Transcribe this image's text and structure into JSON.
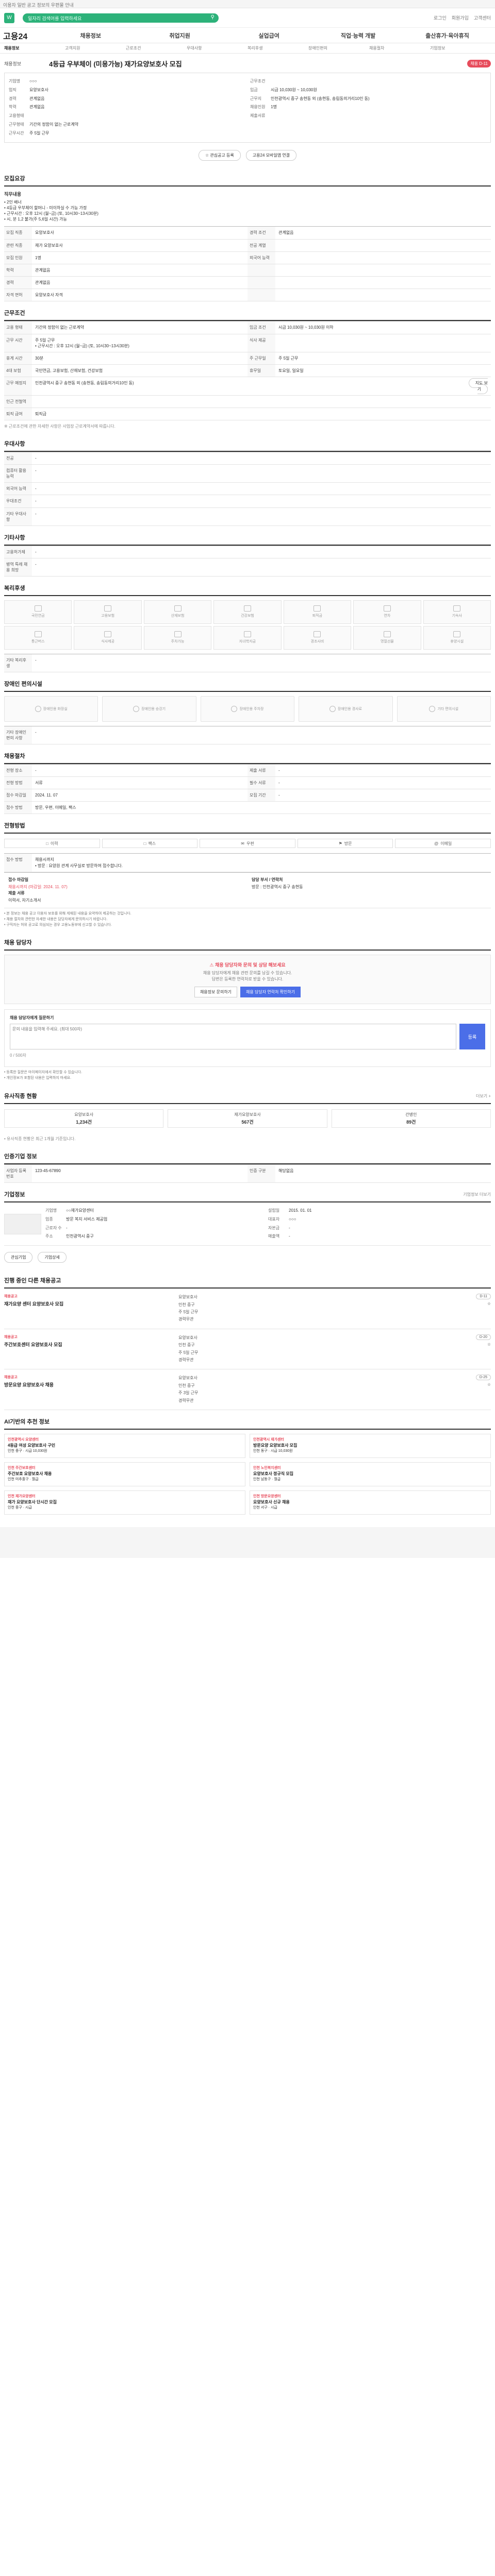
{
  "topbar": {
    "text": "이용자 일반 공고 정보의 우편물 안내"
  },
  "header": {
    "logo": "W",
    "search_placeholder": "일자리 검색어를 입력하세요",
    "links": [
      "로그인",
      "회원가입",
      "고객센터"
    ]
  },
  "gnb": {
    "brand": "고용24",
    "items": [
      "채용정보",
      "취업지원",
      "실업급여",
      "직업·능력 개발",
      "출산휴가·육아휴직"
    ]
  },
  "subnav": {
    "items": [
      "채용정보",
      "고객지원",
      "근로조건",
      "우대사항",
      "복리후생",
      "장애인편의",
      "채용절차",
      "기업정보"
    ]
  },
  "job": {
    "category": "채용정보",
    "title": "4등급 우부체이 (미용가능) 재가요양보호사 모집",
    "badge": "채용 D-11",
    "left_rows": [
      {
        "k": "기업명",
        "v": "○○○"
      },
      {
        "k": "업직",
        "v": "요양보호사"
      },
      {
        "k": "경력",
        "v": "관계없음"
      },
      {
        "k": "학력",
        "v": "관계없음"
      },
      {
        "k": "고용형태",
        "v": ""
      },
      {
        "k": "근무형태",
        "v": "기간의 정함이 없는 근로계약"
      },
      {
        "k": "근무시간",
        "v": "주 5일 근무"
      }
    ],
    "right_rows": [
      {
        "k": "근무조건",
        "v": ""
      },
      {
        "k": "임금",
        "v": "시급 10,030원 ~ 10,030원"
      },
      {
        "k": "근무지",
        "v": "인천광역시 중구 송현동 외 (송현동, 송림동의거리10인 동)"
      },
      {
        "k": "채용인원",
        "v": "1명"
      },
      {
        "k": "제출서류",
        "v": ""
      }
    ],
    "buttons": [
      "관심공고 등록",
      "고용24 모바일앱 연결"
    ]
  },
  "sections": {
    "recruit": "모집요강",
    "conditions": "근무조건",
    "pref": "우대사항",
    "etc": "기타사항",
    "welfare": "복리후생",
    "disabled": "장애인 편의시설",
    "process": "채용절차",
    "apply": "전형방법",
    "consult": "채용 담당자",
    "similar": "유사직종 현황",
    "company": "기업정보",
    "same_co": "인증기업 정보",
    "other_jobs": "진행 중인 다른 채용공고",
    "recommend": "AI기반의 추천 정보"
  },
  "recruit_desc": {
    "title": "직무내용",
    "body": "• 2인 배너\n• 4등급 우부체이 할머니 - 미이하실 수 가능 가정\n• 근무시간 : 오후 12시 (월~금) (토, 10시30~13시30분)\n• 시, 분 1,2 불가(주 5,6일 시간) 가능",
    "rows": [
      {
        "k": "모집 직종",
        "v": "요양보호사"
      },
      {
        "k": "관련 직종",
        "v": "재가 요양보호사"
      },
      {
        "k": "모집 인원",
        "v": "1명"
      },
      {
        "k": "학력",
        "v": "관계없음"
      },
      {
        "k": "경력",
        "v": "관계없음"
      },
      {
        "k": "자격 면허",
        "v": "요양보호사 자격"
      }
    ],
    "right_keys": [
      "경력 조건",
      "전공 계열",
      "외국어 능력",
      "",
      "",
      ""
    ],
    "right_vals": [
      "관계없음",
      "",
      "",
      "",
      "",
      ""
    ]
  },
  "conditions": {
    "rows": [
      {
        "k": "고용 형태",
        "v": "기간의 정함이 없는 근로계약"
      },
      {
        "k": "근무 시간",
        "v": "주 5일 근무\n• 근무시간 : 오후 12시 (월~금) (토, 10시30~13시30분)"
      },
      {
        "k": "휴게 시간",
        "v": "30분"
      },
      {
        "k": "4대 보험",
        "v": "국민연금, 고용보험, 산재보험, 건강보험"
      },
      {
        "k": "근무 예정지",
        "v": "인천광역시 중구 송현동 외 (송현동, 송림동의거리10인 동)"
      },
      {
        "k": "인근 전철역",
        "v": ""
      },
      {
        "k": "퇴직 급여",
        "v": "퇴직금"
      }
    ],
    "right": [
      {
        "k": "임금 조건",
        "v": "시급 10,030원 ~ 10,030원 이하"
      },
      {
        "k": "식사 제공",
        "v": ""
      },
      {
        "k": "주 근무일",
        "v": "주 5일 근무"
      },
      {
        "k": "휴무일",
        "v": "토요일, 일요일"
      },
      {
        "k": "",
        "v": ""
      },
      {
        "k": "",
        "v": ""
      },
      {
        "k": "",
        "v": ""
      }
    ],
    "map_btn": "지도 보기",
    "note": "※ 근로조건에 관한 자세한 사항은 사업장 근로계약서에 따릅니다."
  },
  "pref": {
    "rows": [
      {
        "k": "전공",
        "v": "-"
      },
      {
        "k": "컴퓨터 활용 능력",
        "v": "-"
      },
      {
        "k": "외국어 능력",
        "v": "-"
      },
      {
        "k": "우대조건",
        "v": "-"
      },
      {
        "k": "기타 우대사항",
        "v": "-"
      }
    ]
  },
  "etc": {
    "rows": [
      {
        "k": "고용허가제",
        "v": "-"
      },
      {
        "k": "병역 특례 채용 희망",
        "v": "-"
      }
    ]
  },
  "welfare_items": [
    "국민연금",
    "고용보험",
    "산재보험",
    "건강보험",
    "퇴직금",
    "연차",
    "기숙사",
    "통근버스",
    "식사제공",
    "주차가능",
    "자녀학자금",
    "경조사비",
    "명절선물",
    "휴양시설"
  ],
  "welfare_etc": {
    "k": "기타 복리후생",
    "v": "-"
  },
  "disabled_items": [
    "장애인용 화장실",
    "장애인용 승강기",
    "장애인용 주차장",
    "장애인용 경사로",
    "기타 편의시설"
  ],
  "disabled_etc": {
    "k": "기타 장애인편의 사항",
    "v": "-"
  },
  "process": {
    "rows": [
      {
        "k": "전형 장소",
        "v": "-"
      },
      {
        "k": "전형 방법",
        "v": "서류"
      },
      {
        "k": "접수 마감일",
        "v": "2024. 11. 07"
      },
      {
        "k": "접수 방법",
        "v": "방문, 우편, 이메일, 팩스"
      }
    ],
    "right": [
      {
        "k": "제출 서류",
        "v": "-"
      },
      {
        "k": "필수 서류",
        "v": "-"
      },
      {
        "k": "모집 기간",
        "v": "-"
      },
      {
        "k": "",
        "v": ""
      }
    ]
  },
  "apply_methods": [
    "이력",
    "팩스",
    "우편",
    "방문",
    "이메일"
  ],
  "apply_info": {
    "title": "접수 방법",
    "text": "채용시까지\n• 방문 : 요양원 관계 사무실로 방문하여 접수합니다.",
    "left_title": "접수 마감일",
    "left_val": "채용시까지 (마감일: 2024. 11. 07)",
    "right_title": "담당 부서 / 연락처",
    "right_val": "방문 : 인천광역시 중구 송현동",
    "note_title": "제출 서류",
    "note_val": "이력서, 자기소개서"
  },
  "apply_bullets": [
    "• 본 정보는 채용 공고 이용자 보호를 위해 게재된 내용을 요약하여 제공하는 것입니다.",
    "• 채용 절차와 관련한 자세한 내용은 담당자에게 문의하시기 바랍니다.",
    "• 구직자는 허위 공고로 의심되는 경우 고용노동부에 신고할 수 있습니다."
  ],
  "consult": {
    "t1": "채용 담당자와 문의 및 상담 해보세요",
    "t2": "채용 담당자에게 채용 관련 문의를 남길 수 있습니다.\n답변은 등록한 연락처로 받을 수 있습니다.",
    "btn1": "채용정보 문의하기",
    "btn2": "채용 담당자 연락처 확인하기"
  },
  "qa": {
    "title": "채용 담당자에게 질문하기",
    "placeholder": "문의 내용을 입력해 주세요. (최대 500자)",
    "submit": "등록",
    "count": "0 / 500자"
  },
  "qa_bullets": [
    "• 등록한 질문은 마이페이지에서 확인할 수 있습니다.",
    "• 개인정보가 포함된 내용은 입력하지 마세요."
  ],
  "similar": {
    "more": "더보기 +",
    "boxes": [
      {
        "label": "요양보호사",
        "val": "1,234건"
      },
      {
        "label": "재가요양보호사",
        "val": "567건"
      },
      {
        "label": "간병인",
        "val": "89건"
      }
    ],
    "note": "• 유사직종 현황은 최근 1개월 기준입니다."
  },
  "company": {
    "more": "기업정보 더보기",
    "rows": [
      {
        "k": "기업명",
        "v": "○○재가요양센터"
      },
      {
        "k": "업종",
        "v": "방문 복지 서비스 제공업"
      },
      {
        "k": "근로자 수",
        "v": "-"
      },
      {
        "k": "주소",
        "v": "인천광역시 중구"
      }
    ],
    "right": [
      {
        "k": "설립일",
        "v": "2015. 01. 01"
      },
      {
        "k": "대표자",
        "v": "○○○"
      },
      {
        "k": "자본금",
        "v": "-"
      },
      {
        "k": "매출액",
        "v": "-"
      }
    ],
    "buttons": [
      "관심기업",
      "기업상세"
    ]
  },
  "cert": {
    "rows": [
      {
        "k": "사업자 등록번호",
        "v": "123-45-67890"
      },
      {
        "k": "인증 구분",
        "v": "해당없음"
      }
    ]
  },
  "other_jobs": [
    {
      "co": "채용공고",
      "title": "재가요양 센터 요양보호사 모집",
      "info": [
        "요양보호사",
        "인천 중구",
        "주 5일 근무",
        "경력무관"
      ],
      "tag": "D-11"
    },
    {
      "co": "채용공고",
      "title": "주간보호센터 요양보호사 모집",
      "info": [
        "요양보호사",
        "인천 중구",
        "주 5일 근무",
        "경력무관"
      ],
      "tag": "D-20"
    },
    {
      "co": "채용공고",
      "title": "방문요양 요양보호사 채용",
      "info": [
        "요양보호사",
        "인천 중구",
        "주 3일 근무",
        "경력무관"
      ],
      "tag": "D-25"
    }
  ],
  "recommend": [
    {
      "co": "인천광역시 요양센터",
      "title": "4등급 여성 요양보호사 구인",
      "info": "인천 중구 · 시급 10,030원"
    },
    {
      "co": "인천광역시 재가센터",
      "title": "방문요양 요양보호사 모집",
      "info": "인천 동구 · 시급 10,030원"
    },
    {
      "co": "인천 주간보호센터",
      "title": "주간보호 요양보호사 채용",
      "info": "인천 미추홀구 · 월급"
    },
    {
      "co": "인천 노인복지센터",
      "title": "요양보호사 정규직 모집",
      "info": "인천 남동구 · 월급"
    },
    {
      "co": "인천 재가요양센터",
      "title": "재가 요양보호사 단시간 모집",
      "info": "인천 중구 · 시급"
    },
    {
      "co": "인천 방문요양센터",
      "title": "요양보호사 신규 채용",
      "info": "인천 서구 · 시급"
    }
  ]
}
